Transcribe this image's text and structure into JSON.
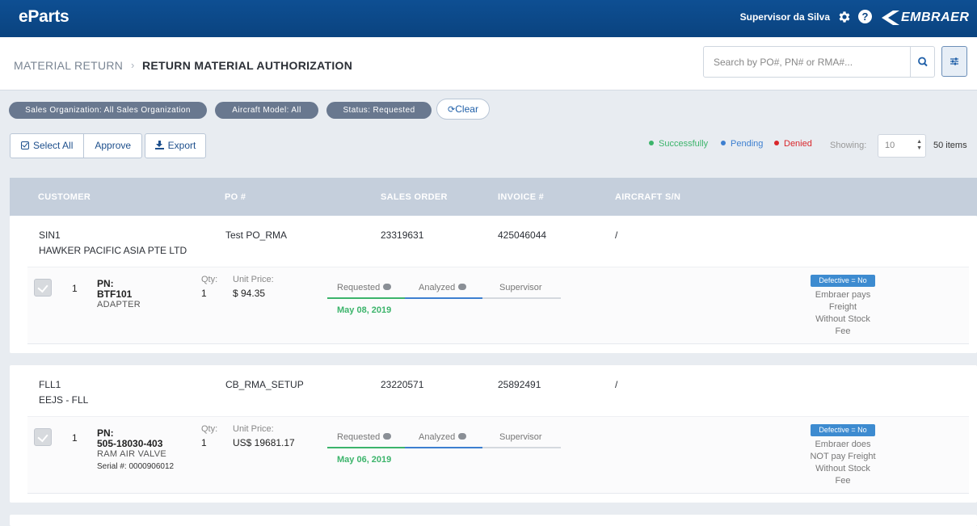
{
  "app": {
    "brand": "eParts",
    "user_name": "Supervisor da Silva",
    "company_logo_text": "EMBRAER"
  },
  "breadcrumb": {
    "parent": "MATERIAL RETURN",
    "current": "RETURN MATERIAL AUTHORIZATION"
  },
  "search": {
    "placeholder": "Search by PO#, PN# or RMA#..."
  },
  "filters": [
    {
      "label": "Sales Organization: All Sales Organization"
    },
    {
      "label": "Aircraft Model: All"
    },
    {
      "label": "Status: Requested"
    }
  ],
  "clear_label": "Clear",
  "actions": {
    "select_all": "Select All",
    "approve": "Approve",
    "export": "Export"
  },
  "legend": [
    {
      "label": "Successfully",
      "color": "#3cb46b"
    },
    {
      "label": "Pending",
      "color": "#3d7fd0"
    },
    {
      "label": "Denied",
      "color": "#d9262b"
    }
  ],
  "paging": {
    "showing_label": "Showing:",
    "page_size": "10",
    "items_count": "50 items"
  },
  "table": {
    "headers": [
      "CUSTOMER",
      "PO #",
      "SALES ORDER",
      "INVOICE #",
      "AIRCRAFT S/N"
    ],
    "rows": [
      {
        "customer_code": "SIN1",
        "customer_name": "HAWKER PACIFIC ASIA PTE LTD",
        "po": "Test PO_RMA",
        "sales_order": "23319631",
        "invoice": "425046044",
        "aircraft_sn": "/",
        "item": {
          "index": "1",
          "pn_label": "PN:",
          "pn": "BTF101",
          "description": "ADAPTER",
          "serial": "",
          "qty_label": "Qty:",
          "qty": "1",
          "price_label": "Unit Price:",
          "price": "$ 94.35",
          "steps": [
            "Requested",
            "Analyzed",
            "Supervisor"
          ],
          "date": "May 08, 2019",
          "defective_badge": "Defective = No",
          "fee_text": [
            "Embraer pays",
            "Freight",
            "Without Stock",
            "Fee"
          ]
        }
      },
      {
        "customer_code": "FLL1",
        "customer_name": "EEJS - FLL",
        "po": "CB_RMA_SETUP",
        "sales_order": "23220571",
        "invoice": "25892491",
        "aircraft_sn": "/",
        "item": {
          "index": "1",
          "pn_label": "PN:",
          "pn": "505-18030-403",
          "description": "RAM AIR VALVE",
          "serial": "Serial #: 0000906012",
          "qty_label": "Qty:",
          "qty": "1",
          "price_label": "Unit Price:",
          "price": "US$ 19681.17",
          "steps": [
            "Requested",
            "Analyzed",
            "Supervisor"
          ],
          "date": "May 06, 2019",
          "defective_badge": "Defective = No",
          "fee_text": [
            "Embraer does",
            "NOT pay Freight",
            "Without Stock",
            "Fee"
          ]
        }
      }
    ]
  }
}
